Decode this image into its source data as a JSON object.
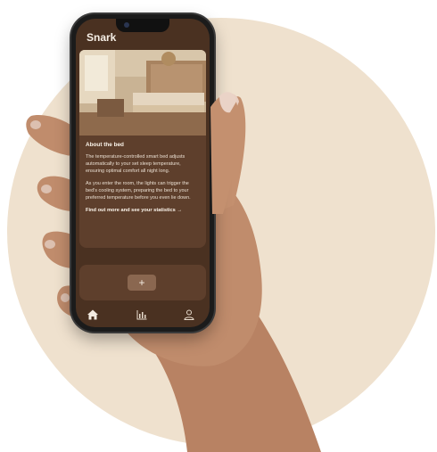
{
  "app": {
    "title": "Snark"
  },
  "about": {
    "heading": "About the bed",
    "paragraph1": "The temperature-controlled smart bed adjusts automatically to your set sleep temperature, ensuring optimal comfort all night long.",
    "paragraph2": "As you enter the room, the lights can trigger the bed's cooling system, preparing the bed to your preferred temperature before you even lie down.",
    "link": "Find out more and see your statistics →"
  },
  "add_card": {
    "button_label": "+"
  },
  "tabbar": {
    "icons": [
      "home-icon",
      "bar-chart-icon",
      "user-icon"
    ]
  },
  "colors": {
    "background_circle": "#efe1ce",
    "screen_bg": "#4a3121",
    "card_bg": "#5e3f2c",
    "button_bg": "#8a6750"
  }
}
